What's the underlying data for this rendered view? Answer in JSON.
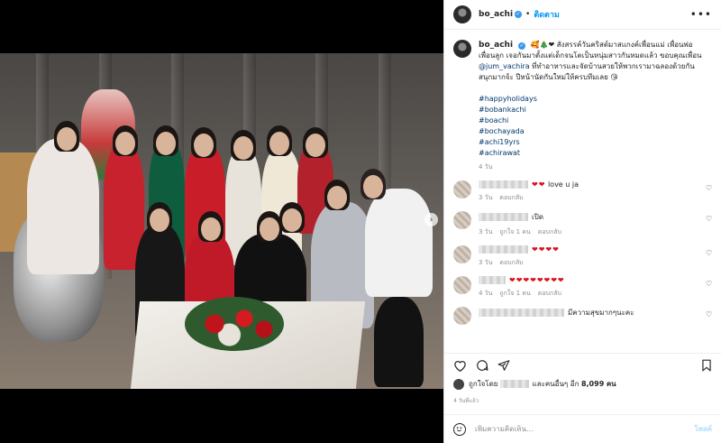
{
  "post": {
    "username": "bo_achi",
    "follow_label": "ติดตาม",
    "more_label": "•••"
  },
  "caption": {
    "username": "bo_achi",
    "emoji_prefix": "🥰🎄❤",
    "text_1": "สังสรรค์วันคริสต์มาสแกงค์เพื่อนแม่ เพื่อนพ่อ เพื่อนลูก เจอกันมาตั้งแต่เด็กจนโตเป็นหนุ่มสาวกันหมดแล้ว ขอบคุณเพื่อน",
    "mention": "@jum_vachira",
    "text_2": "ที่ทำอาหารและจัดบ้านสวยให้พวกเรามาฉลองด้วยกัน สนุกมากจ้ะ ปีหน้านัดกันใหม่ให้ครบทีมเลย 😘",
    "hashtags": [
      "#happyholidays",
      "#bobankachi",
      "#boachi",
      "#bochayada",
      "#achi19yrs",
      "#achirawat"
    ],
    "time": "4 วัน"
  },
  "comments": [
    {
      "text": "❤❤ love u ja",
      "hearts": "❤❤",
      "body": "love u ja",
      "age": "3 วัน",
      "likes": "",
      "reply": "ตอบกลับ"
    },
    {
      "text": "เปิด",
      "hearts": "",
      "body": "เปิด",
      "age": "3 วัน",
      "likes": "ถูกใจ 1 คน",
      "reply": "ตอบกลับ"
    },
    {
      "text": "❤❤❤❤",
      "hearts": "❤❤❤❤",
      "body": "",
      "age": "3 วัน",
      "likes": "",
      "reply": "ตอบกลับ"
    },
    {
      "text": "❤❤❤❤❤❤❤❤",
      "hearts": "❤❤❤❤❤❤❤❤",
      "body": "",
      "age": "4 วัน",
      "likes": "ถูกใจ 1 คน",
      "reply": "ตอบกลับ"
    },
    {
      "text": "มีความสุขมากๆนะคะ",
      "hearts": "",
      "body": "มีความสุขมากๆนะคะ",
      "age": "",
      "likes": "",
      "reply": ""
    }
  ],
  "likes": {
    "prefix": "ถูกใจโดย",
    "middle": "และคนอื่นๆ อีก",
    "count": "8,099",
    "suffix": "คน"
  },
  "post_date": "4 วันที่แล้ว",
  "add_comment": {
    "placeholder": "เพิ่มความคิดเห็น...",
    "post_label": "โพสต์"
  },
  "carousel": {
    "count": 9,
    "active_index": 0
  },
  "colors": {
    "link": "#0095f6",
    "heart": "#d8141e",
    "verified": "#3897f0"
  }
}
